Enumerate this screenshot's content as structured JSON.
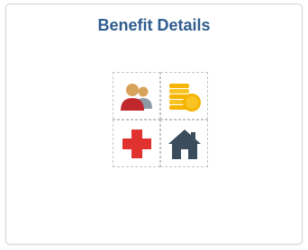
{
  "tile": {
    "title": "Benefit Details"
  },
  "icons": [
    {
      "name": "people-icon",
      "colors": {
        "primary": "#c0282d",
        "secondary": "#8d9aa6",
        "skin": "#d9a25a"
      }
    },
    {
      "name": "coins-icon",
      "colors": {
        "primary": "#f5b400",
        "secondary": "#f7c325"
      }
    },
    {
      "name": "medical-cross-icon",
      "colors": {
        "primary": "#e0322f"
      }
    },
    {
      "name": "house-icon",
      "colors": {
        "primary": "#3b4d5c"
      }
    }
  ],
  "colors": {
    "title": "#2f5d8e",
    "tile_border": "#d4d4d4",
    "grid_lines": "#c6c6c6"
  }
}
